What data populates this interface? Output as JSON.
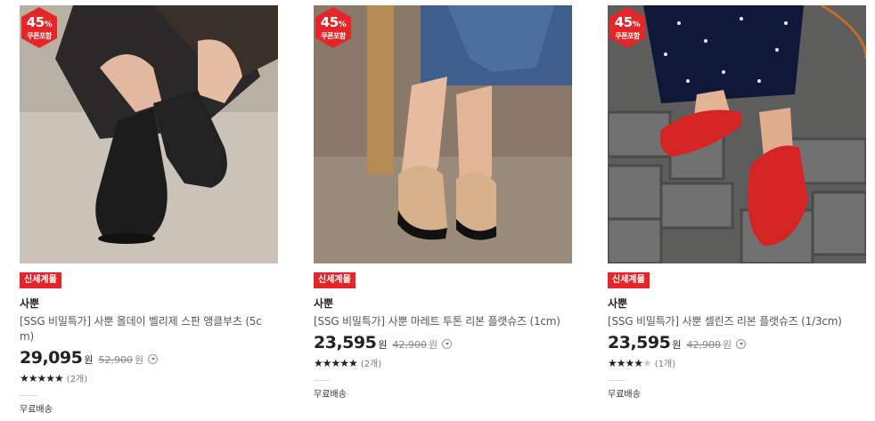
{
  "products": [
    {
      "discount_pct": "45",
      "discount_unit": "%",
      "coupon_label": "쿠폰포함",
      "store_tag": "신세계몰",
      "brand": "사뿐",
      "title_line1": "[SSG 비밀특가] 사뿐 올데이 벨리제 스판 앵클부츠 (5c",
      "title_line2": "m)",
      "price": "29,095",
      "won": "원",
      "original_price": "52,900",
      "original_won": "원",
      "stars_filled": "★★★★★",
      "stars_empty": "",
      "review_count": "(2개)",
      "shipping": "무료배송",
      "image_icon": "black-ankle-boots-photo"
    },
    {
      "discount_pct": "45",
      "discount_unit": "%",
      "coupon_label": "쿠폰포함",
      "store_tag": "신세계몰",
      "brand": "사뿐",
      "title_line1": "[SSG 비밀특가] 사뿐 마레트 투톤 리본 플랫슈즈 (1cm)",
      "title_line2": "",
      "price": "23,595",
      "won": "원",
      "original_price": "42,900",
      "original_won": "원",
      "stars_filled": "★★★★★",
      "stars_empty": "",
      "review_count": "(2개)",
      "shipping": "무료배송",
      "image_icon": "two-tone-flat-shoes-photo"
    },
    {
      "discount_pct": "45",
      "discount_unit": "%",
      "coupon_label": "쿠폰포함",
      "store_tag": "신세계몰",
      "brand": "사뿐",
      "title_line1": "[SSG 비밀특가] 사뿐 셀린즈 리본 플랫슈즈 (1/3cm)",
      "title_line2": "",
      "price": "23,595",
      "won": "원",
      "original_price": "42,900",
      "original_won": "원",
      "stars_filled": "★★★★",
      "stars_empty": "★",
      "review_count": "(1개)",
      "shipping": "무료배송",
      "image_icon": "red-flat-shoes-photo"
    }
  ],
  "colors": {
    "badge_red": "#e52528",
    "text_dark": "#222222",
    "text_gray": "#888888"
  }
}
